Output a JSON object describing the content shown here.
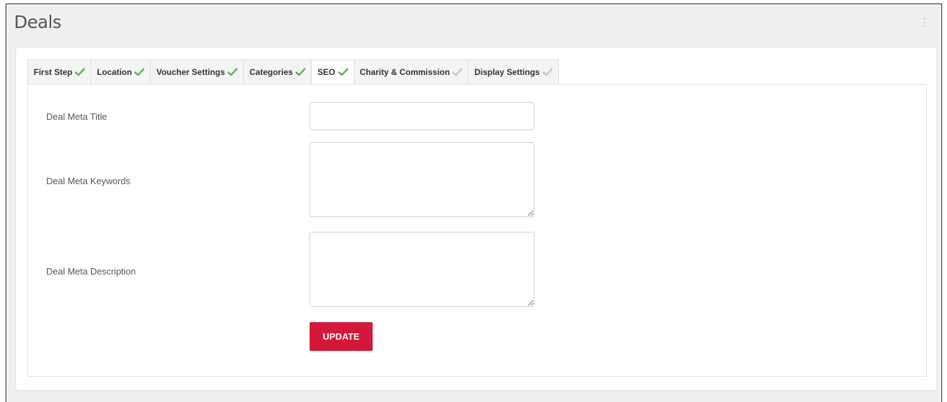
{
  "page": {
    "title": "Deals"
  },
  "colors": {
    "check_done": "#5cb85c",
    "check_pending": "#c8c8c8",
    "primary_button": "#d3183a"
  },
  "tabs": [
    {
      "label": "First Step",
      "status": "complete",
      "icon": "check-icon"
    },
    {
      "label": "Location",
      "status": "complete",
      "icon": "check-icon"
    },
    {
      "label": "Voucher Settings",
      "status": "complete",
      "icon": "check-icon"
    },
    {
      "label": "Categories",
      "status": "complete",
      "icon": "check-icon"
    },
    {
      "label": "SEO",
      "status": "complete",
      "icon": "check-icon",
      "active": true
    },
    {
      "label": "Charity & Commission",
      "status": "pending",
      "icon": "check-icon"
    },
    {
      "label": "Display Settings",
      "status": "pending",
      "icon": "check-icon"
    }
  ],
  "form": {
    "meta_title": {
      "label": "Deal Meta Title",
      "value": "",
      "placeholder": ""
    },
    "meta_keywords": {
      "label": "Deal Meta Keywords",
      "value": "",
      "placeholder": ""
    },
    "meta_description": {
      "label": "Deal Meta Description",
      "value": "",
      "placeholder": ""
    },
    "update_label": "UPDATE"
  }
}
